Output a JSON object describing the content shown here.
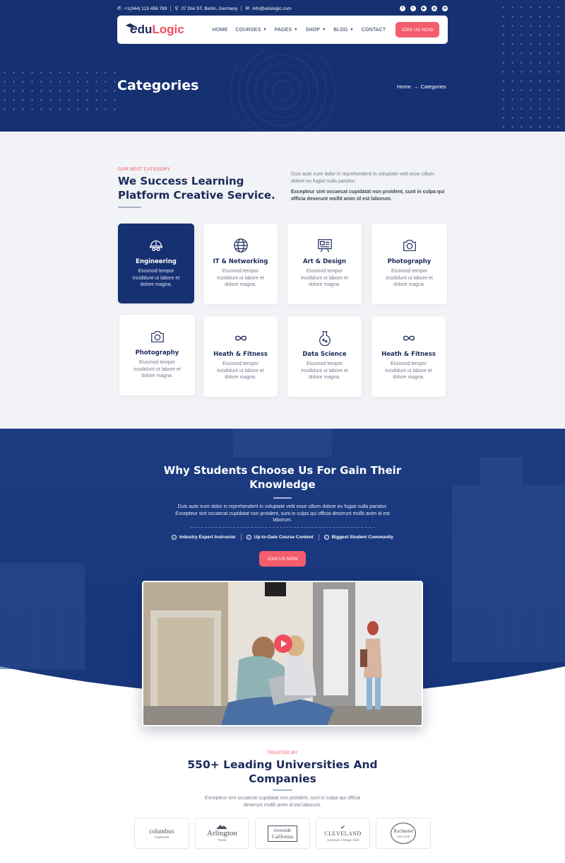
{
  "colors": {
    "primary": "#163172",
    "accent": "#f14d5d",
    "button": "#f35d6d",
    "section_bg": "#f2f3f6"
  },
  "topbar": {
    "phone": "+1(044) 123 456 789",
    "address": "27 Divi ST, Berlin, Germany",
    "email": "info@edulogic.com",
    "social_icons": [
      "facebook-icon",
      "twitter-icon",
      "youtube-icon",
      "instagram-icon",
      "linkedin-icon"
    ]
  },
  "header": {
    "logo": {
      "e": "e",
      "du": "du",
      "logic": "Logic"
    },
    "nav": [
      {
        "label": "HOME",
        "dropdown": false
      },
      {
        "label": "COURSES",
        "dropdown": true
      },
      {
        "label": "PAGES",
        "dropdown": true
      },
      {
        "label": "SHOP",
        "dropdown": true
      },
      {
        "label": "BLOG",
        "dropdown": true
      },
      {
        "label": "CONTACT",
        "dropdown": false
      }
    ],
    "cta": "JOIN US NOW"
  },
  "hero": {
    "title": "Categories",
    "breadcrumb": {
      "home": "Home",
      "arrow": "→",
      "current": "Categories"
    }
  },
  "categories": {
    "eyebrow": "OUR BEST CATEGORY",
    "heading": "We Success Learning Platform Creative Service.",
    "desc": "Duis aute irure dolor in reprehenderit in voluptate velit esse cillum dolore eu fugiat nulla pariatur.",
    "desc_bold": "Excepteur sint occaecat cupidatat non proident, sunt in culpa qui officia deserunt mollit anim id est laborum.",
    "cards": [
      {
        "title": "Engineering",
        "text": "Eiusmod tempor incididunt ut labore et dolore magna.",
        "icon": "engineer-helmet-icon",
        "active": true
      },
      {
        "title": "IT & Networking",
        "text": "Eiusmod tempor incididunt ut labore et dolore magna.",
        "icon": "globe-icon",
        "active": false
      },
      {
        "title": "Art & Design",
        "text": "Eiusmod tempor incididunt ut labore et dolore magna.",
        "icon": "design-board-icon",
        "active": false
      },
      {
        "title": "Photography",
        "text": "Eiusmod tempor incididunt ut labore et dolore magna.",
        "icon": "camera-icon",
        "active": false
      },
      {
        "title": "Photography",
        "text": "Eiusmod tempor incididunt ut labore et dolore magna.",
        "icon": "camera-icon",
        "active": false
      },
      {
        "title": "Heath & Fitness",
        "text": "Eiusmod tempor incididunt ut labore et dolore magna.",
        "icon": "infinity-icon",
        "active": false
      },
      {
        "title": "Data Science",
        "text": "Eiusmod tempor incididunt ut labore et dolore magna.",
        "icon": "flask-icon",
        "active": false
      },
      {
        "title": "Heath & Fitness",
        "text": "Eiusmod tempor incididunt ut labore et dolore magna.",
        "icon": "infinity-icon",
        "active": false
      }
    ]
  },
  "why": {
    "title": "Why Students Choose Us For Gain Their Knowledge",
    "desc": "Duis aute irure dolor in reprehenderit in voluptate velit esse cillum dolore eu fugiat nulla pariatur. Excepteur sint occaecat cupidatat non proident, sunt in culpa qui officia deserunt mollit anim id est laborum.",
    "features": [
      "Industry Expert Instructor",
      "Up-to-Date Course Content",
      "Biggest Student Community"
    ],
    "cta": "JOIN US NOW"
  },
  "trusted": {
    "eyebrow": "TRUSTED BY",
    "title": "550+ Leading Universities And Companies",
    "desc": "Excepteur sint occaecat cupidatat non proident, sunt in culpa qui officia deserunt mollit anim id est laborum.",
    "partners": [
      {
        "name": "columbus",
        "sub": "Trademark"
      },
      {
        "name": "Arlington",
        "sub": "Texas"
      },
      {
        "name": "riverside",
        "sub": "California"
      },
      {
        "name": "CLEVELAND",
        "sub": "American Vintage Club"
      },
      {
        "name": "Rochester",
        "sub": "new york"
      }
    ]
  }
}
